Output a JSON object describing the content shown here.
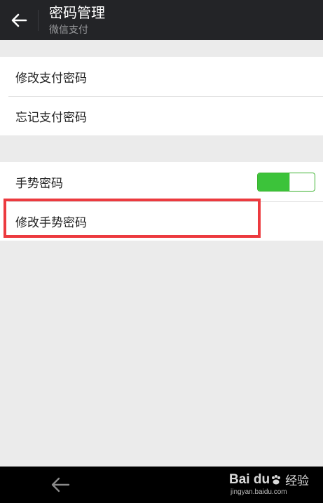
{
  "header": {
    "title": "密码管理",
    "subtitle": "微信支付",
    "back_icon": "arrow-left-icon"
  },
  "group1": {
    "items": [
      {
        "label": "修改支付密码"
      },
      {
        "label": "忘记支付密码"
      }
    ]
  },
  "group2": {
    "items": [
      {
        "label": "手势密码",
        "toggle": {
          "on": true,
          "fill_fraction": 0.56
        }
      },
      {
        "label": "修改手势密码",
        "highlighted": true
      }
    ]
  },
  "navbar": {
    "back_icon": "arrow-left-icon"
  },
  "watermark": {
    "logo": "Bai du",
    "jingyan": "经验",
    "url": "jingyan.baidu.com"
  },
  "colors": {
    "header_bg": "#232427",
    "page_bg": "#ebebeb",
    "toggle_green": "#3cc33a",
    "highlight_red": "#ec3a3f"
  }
}
